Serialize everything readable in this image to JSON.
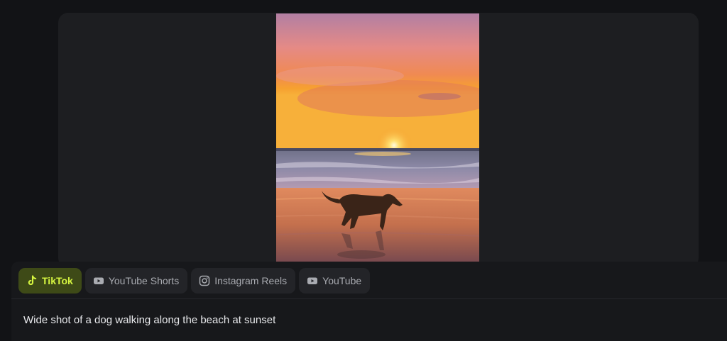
{
  "video": {
    "description_icon": "sunset-beach-dog-video"
  },
  "platform_tabs": [
    {
      "label": "TikTok",
      "icon": "tiktok-icon",
      "active": true
    },
    {
      "label": "YouTube Shorts",
      "icon": "youtube-play-icon",
      "active": false
    },
    {
      "label": "Instagram Reels",
      "icon": "instagram-icon",
      "active": false
    },
    {
      "label": "YouTube",
      "icon": "youtube-play-icon",
      "active": false
    }
  ],
  "caption": "Wide shot of a dog walking along the beach at sunset",
  "colors": {
    "active_tab_bg": "#3e4a17",
    "active_tab_text": "#d5f540",
    "tab_bg": "#232428",
    "page_bg": "#121316"
  }
}
